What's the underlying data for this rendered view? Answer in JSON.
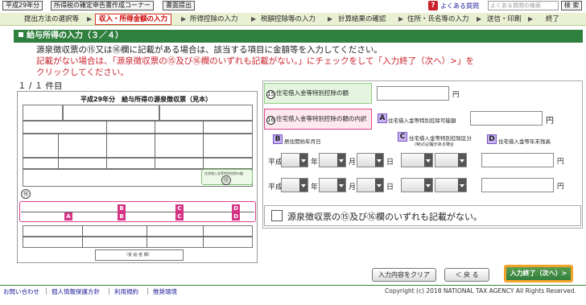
{
  "toolbar": {
    "btn1": "平成29年分",
    "btn2": "所得税の確定申告書作成コーナー",
    "btn3": "書面提出",
    "help": "よくある質問",
    "search_placeholder": "よくある質問の検索",
    "search_btn": "検 索"
  },
  "steps": {
    "s1": "提出方法の選択等",
    "s2": "収入・所得金額の入力",
    "s3": "所得控除の入力",
    "s4": "税額控除等の入力",
    "s5": "計算結果の確認",
    "s6": "住所・氏名等の入力",
    "s7": "送信・印刷",
    "s8": "終了"
  },
  "title": "給与所得の入力（３／４）",
  "instructions": {
    "line1": "源泉徴収票の⑮又は⑯欄に記載がある場合は、該当する項目に金額等を入力してください。",
    "line2": "記載がない場合は、「源泉徴収票の⑮及び⑯欄のいずれも記載がない。」にチェックをして「入力終了（次へ）>」を",
    "line3": "クリックしてください。"
  },
  "count": "１ / １ 件目",
  "receipt": {
    "title": "平成29年分　給与所得の源泉徴収票（見本）",
    "c15": "⑮",
    "c16": "⑯",
    "green_label": "住宅借入金等特別控除の額",
    "bottom": "（受 給 者 欄）",
    "badge_a": "A",
    "badge_b": "B",
    "badge_c": "C",
    "badge_d": "D"
  },
  "form": {
    "f15_label": "住宅借入金等特別控除の額",
    "f15_unit": "円",
    "f16_label": "住宅借入金等特別控除の額の内訳",
    "a_label": "住宅借入金等特別控除可能額",
    "a_unit": "円",
    "b_label": "居住開始年月日",
    "c_label": "住宅借入金等特別控除区分",
    "c_sub": "(特)の記載がある場合",
    "d_label": "住宅借入金等年末残高",
    "era": "平成",
    "year": "年",
    "month": "月",
    "day": "日",
    "yen": "円",
    "badge_a": "A",
    "badge_b": "B",
    "badge_c": "C",
    "badge_d": "D",
    "n15": "15",
    "n16": "16",
    "no_entry": "源泉徴収票の⑮及び⑯欄のいずれも記載がない。"
  },
  "buttons": {
    "clear": "入力内容をクリア",
    "back": "＜ 戻 る",
    "next": "入力終了（次へ）>"
  },
  "footer": {
    "contact": "お問い合わせ",
    "privacy": "個人情報保護方針",
    "terms": "利用規約",
    "env": "推奨環境",
    "copyright": "Copyright (c) 2018 NATIONAL TAX AGENCY All Rights Reserved."
  }
}
